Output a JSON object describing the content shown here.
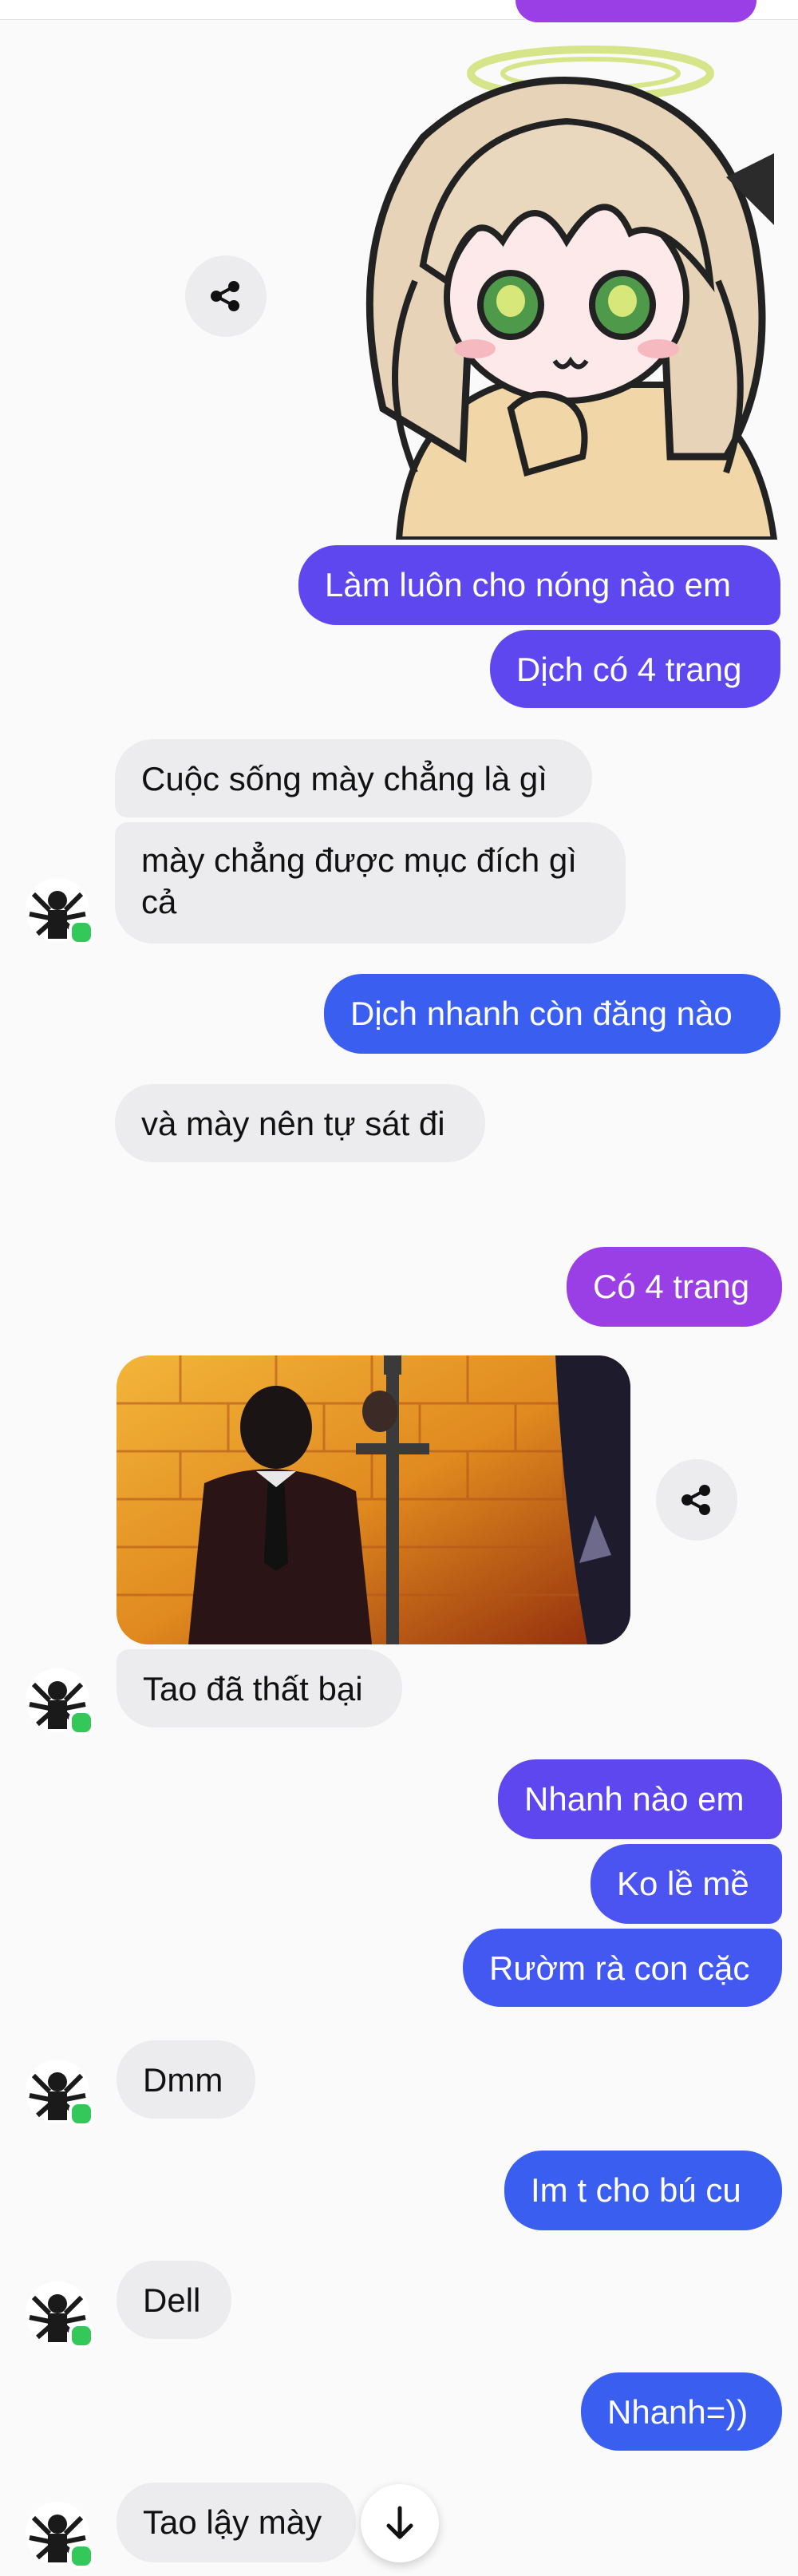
{
  "colors": {
    "outgoing_indigo": "#5e47ef",
    "outgoing_blue": "#3a5ff0",
    "outgoing_purple": "#9a3ee6",
    "incoming_gray": "#ececee",
    "online_green": "#34c759"
  },
  "messages": {
    "out_lam_luon": "Làm luôn cho nóng nào em",
    "out_dich_co_4_trang": "Dịch có 4 trang",
    "in_cuoc_song": "Cuộc sống mày chẳng là gì",
    "in_may_chang_1": "mày chẳng được mục đích gì",
    "in_may_chang_2": "cả",
    "out_dich_nhanh": "Dịch nhanh còn đăng nào",
    "in_va_may": "và mày nên tự sát đi",
    "out_co_4_trang": "Có 4 trang",
    "in_tao_da_that_bai": "Tao đã thất bại",
    "out_nhanh_nao_em": "Nhanh nào em",
    "out_ko_le_me": "Ko lề mề",
    "out_ruom_ra": "Rườm rà con cặc",
    "in_dmm": "Dmm",
    "out_im_t": "Im t cho bú cu",
    "in_dell": "Dell",
    "out_nhanh_smile": "Nhanh=))",
    "in_tao_lay_may": "Tao lậy mày"
  },
  "icons": {
    "share": "share-icon",
    "scroll_down": "arrow-down-icon",
    "avatar": "contact-avatar"
  }
}
